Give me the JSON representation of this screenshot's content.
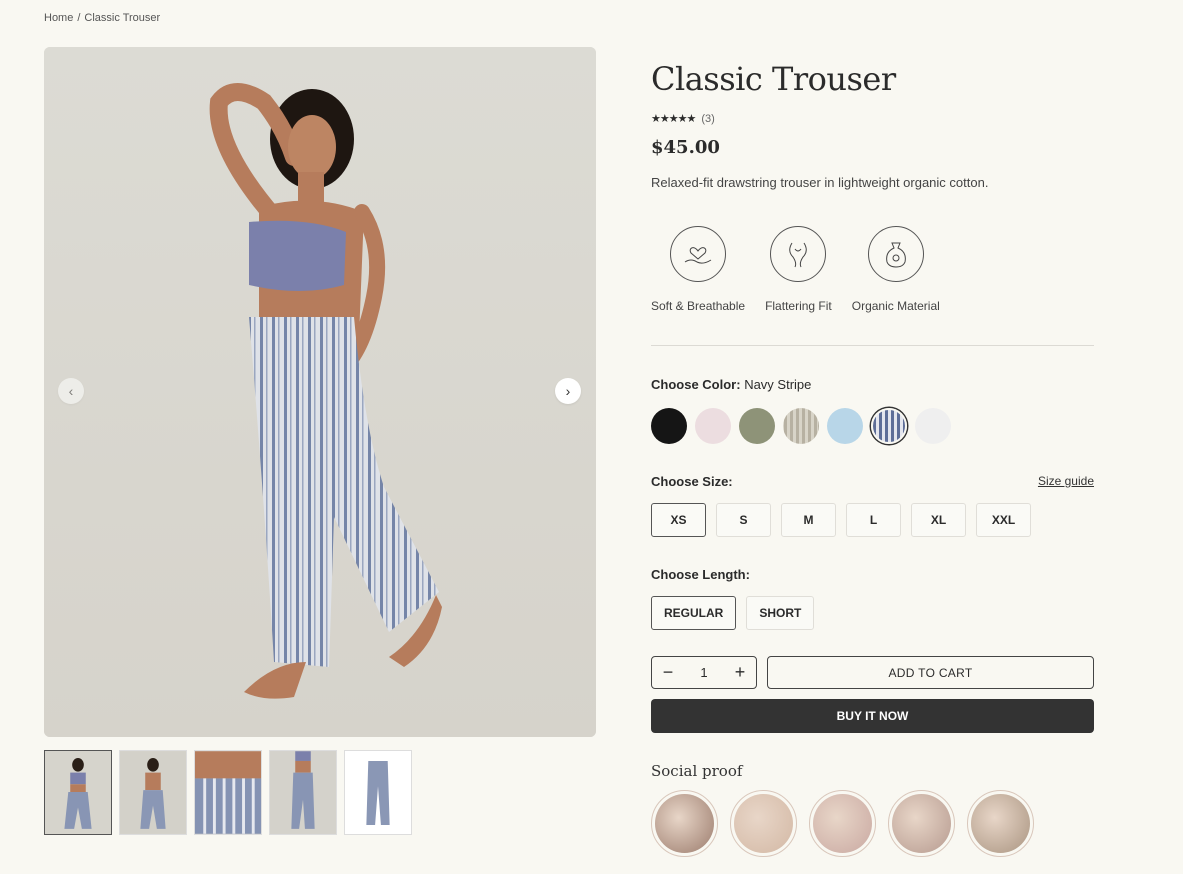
{
  "breadcrumb": {
    "home": "Home",
    "separator": "/",
    "current": "Classic Trouser"
  },
  "product": {
    "title": "Classic Trouser",
    "stars": "★★★★★",
    "review_count": "(3)",
    "rating_value": 5,
    "price": "$45.00",
    "description": "Relaxed-fit drawstring trouser in lightweight organic cotton."
  },
  "gallery": {
    "prev_icon": "‹",
    "next_icon": "›",
    "thumbnail_count": 5,
    "active_thumbnail": 0
  },
  "features": [
    {
      "icon": "heart-hand-icon",
      "label": "Soft & Breathable"
    },
    {
      "icon": "hands-fit-icon",
      "label": "Flattering Fit"
    },
    {
      "icon": "cotton-bag-icon",
      "label": "Organic Material"
    }
  ],
  "color": {
    "label": "Choose Color:",
    "selected": "Navy Stripe",
    "swatches": [
      "#151515",
      "#ecdde0",
      "#8e9378",
      "#b7b1a2",
      "#b8d6e8",
      "#5e6e98",
      "#efefef"
    ],
    "selected_index": 5
  },
  "size": {
    "label": "Choose Size:",
    "guide": "Size guide",
    "options": [
      "XS",
      "S",
      "M",
      "L",
      "XL",
      "XXL"
    ],
    "selected_index": 0
  },
  "length": {
    "label": "Choose Length:",
    "options": [
      "REGULAR",
      "SHORT"
    ],
    "selected_index": 0
  },
  "cart": {
    "minus": "−",
    "quantity": "1",
    "plus": "+",
    "add_to_cart": "ADD TO CART",
    "buy_now": "BUY IT NOW"
  },
  "social": {
    "title": "Social proof",
    "avatars": [
      "#9b7b6c",
      "#d3b8a4",
      "#c9a8a1",
      "#b69a8f",
      "#a99480"
    ]
  }
}
